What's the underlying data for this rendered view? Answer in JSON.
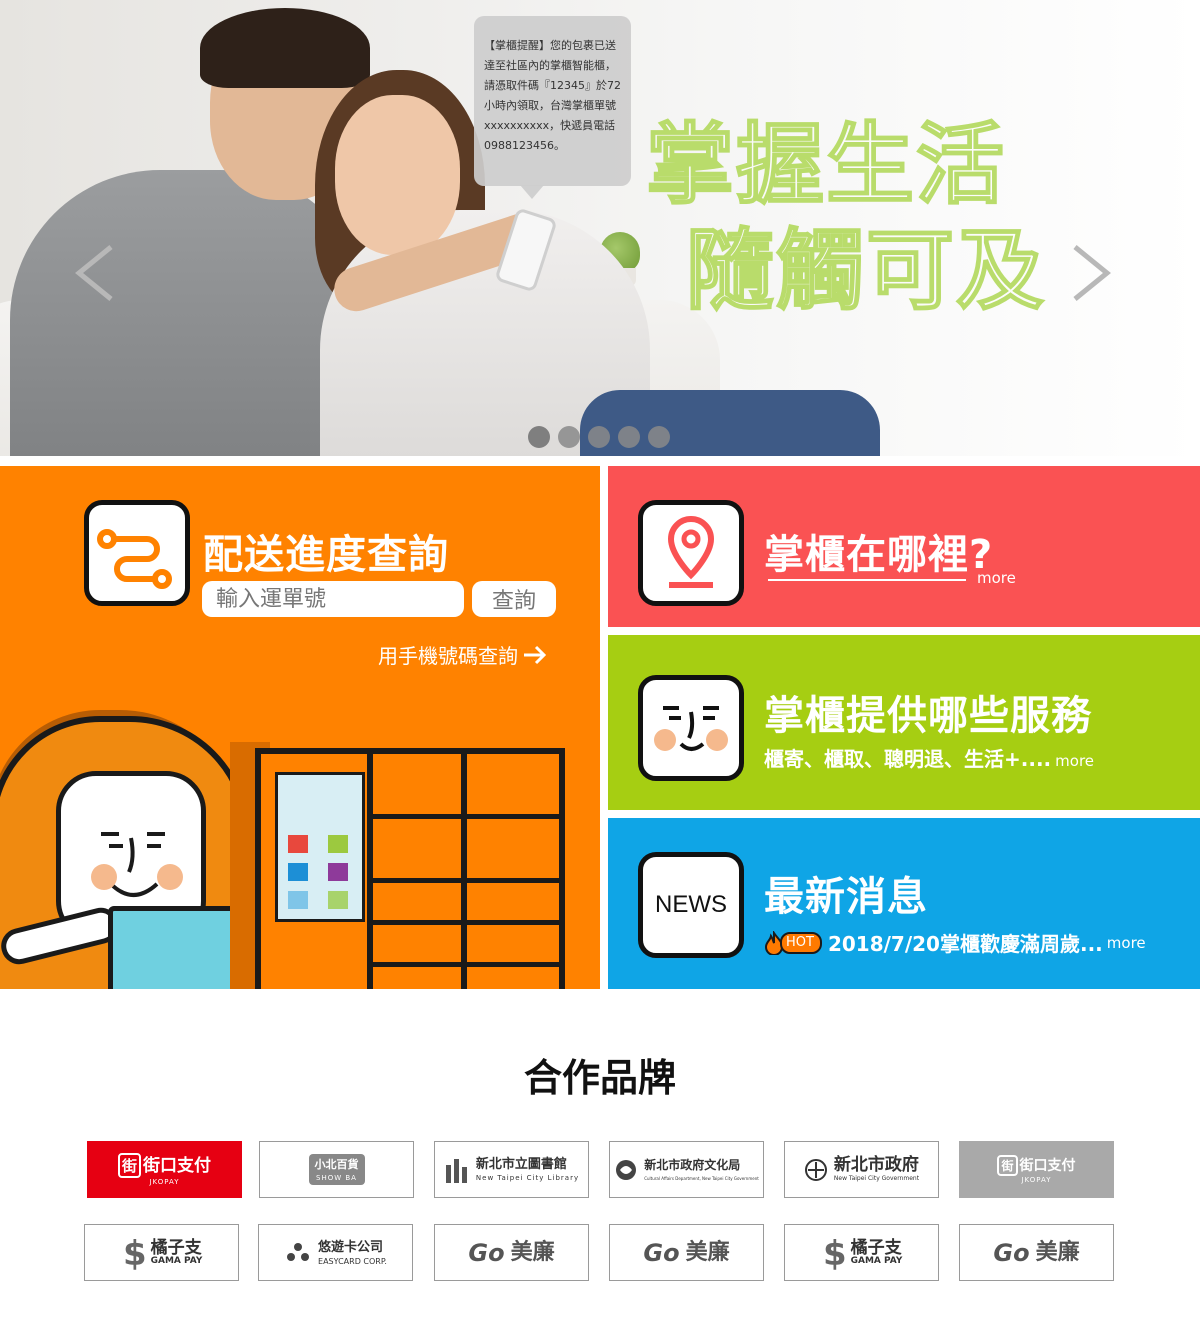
{
  "hero": {
    "bubble_text": "【掌櫃提醒】您的包裹已送達至社區內的掌櫃智能櫃，請憑取件碼『12345』於72小時內領取，台灣掌櫃單號xxxxxxxxxx，快遞員電話0988123456。",
    "slogan_line1": "掌握生活",
    "slogan_line2": "隨觸可及",
    "dots_count": 5,
    "active_dot": 0
  },
  "tracking": {
    "title": "配送進度查詢",
    "input_placeholder": "輸入運單號",
    "button_label": "查詢",
    "phone_link": "用手機號碼查詢"
  },
  "locations": {
    "title": "掌櫃在哪裡?",
    "more": "more"
  },
  "services": {
    "title": "掌櫃提供哪些服務",
    "subtitle": "櫃寄、櫃取、聰明退、生活+....",
    "more": "more"
  },
  "news": {
    "icon_label": "NEWS",
    "title": "最新消息",
    "hot_label": "HOT",
    "headline": "2018/7/20掌櫃歡慶滿周歲...",
    "more": "more"
  },
  "partners": {
    "title": "合作品牌",
    "row1": [
      {
        "name": "街口支付",
        "sub": "JKOPAY"
      },
      {
        "name": "小北百貨",
        "sub": "SHOW BA"
      },
      {
        "name": "新北市立圖書館",
        "sub": "New Taipei City Library"
      },
      {
        "name": "新北市政府文化局",
        "sub": "Cultural Affairs Department, New Taipei City Government"
      },
      {
        "name": "新北市政府",
        "sub": "New Taipei City Government"
      },
      {
        "name": "街口支付",
        "sub": "JKOPAY"
      }
    ],
    "row2": [
      {
        "name": "橘子支",
        "sub": "GAMA PAY"
      },
      {
        "name": "悠遊卡公司",
        "sub": "EASYCARD CORP."
      },
      {
        "name": "美廉",
        "prefix": "Go"
      },
      {
        "name": "美廉",
        "prefix": "Go"
      },
      {
        "name": "橘子支",
        "sub": "GAMA PAY"
      },
      {
        "name": "美廉",
        "prefix": "Go"
      }
    ]
  },
  "colors": {
    "orange": "#ff8200",
    "red": "#fa5253",
    "green": "#a6ce12",
    "blue": "#0fa5e6",
    "slogan_stroke": "#b9dc6b"
  }
}
